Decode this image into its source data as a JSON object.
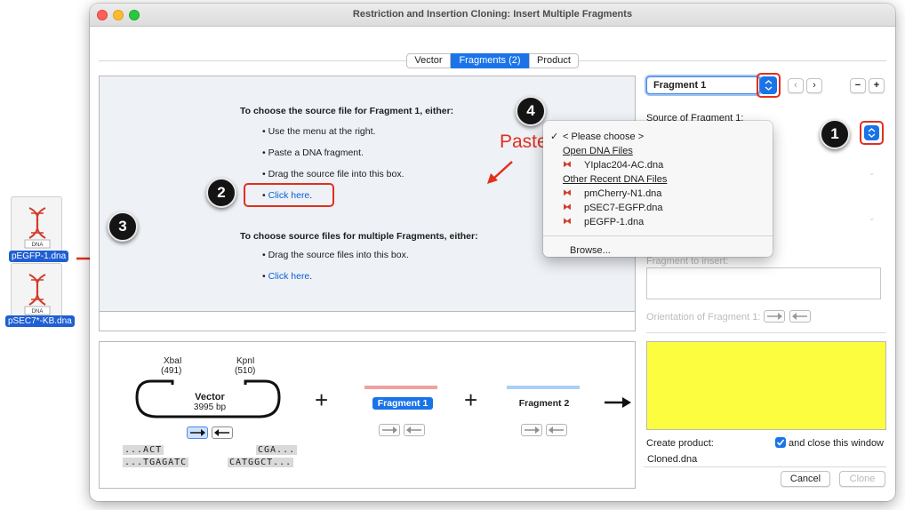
{
  "window": {
    "title": "Restriction and Insertion Cloning: Insert Multiple Fragments"
  },
  "tabs": [
    {
      "label": "Vector",
      "selected": false
    },
    {
      "label": "Fragments (2)",
      "selected": true
    },
    {
      "label": "Product",
      "selected": false
    }
  ],
  "dropzone": {
    "heading_single": "To choose the source file for Fragment 1, either:",
    "bullets_single": [
      "Use the menu at the right.",
      "Paste a DNA fragment.",
      "Drag the source file into this box."
    ],
    "click_here": "Click here",
    "period": ".",
    "heading_multi": "To choose source files for multiple Fragments, either:",
    "bullets_multi": [
      "Drag the source files into this box."
    ]
  },
  "annotations": {
    "paste": "Paste",
    "callouts": [
      "1",
      "2",
      "3",
      "4"
    ]
  },
  "desktop_files": [
    {
      "name": "pEGFP-1.dna",
      "type": "DNA"
    },
    {
      "name": "pSEC7*-KB.dna",
      "type": "DNA"
    }
  ],
  "right_panel": {
    "fragment_select": "Fragment 1",
    "source_label": "Source of Fragment 1:",
    "fragment_to_insert_label": "Fragment to insert:",
    "orientation_label": "Orientation of Fragment 1:",
    "create_product_label": "Create product:",
    "close_window_label": "and close this window",
    "close_window_checked": true,
    "product_name": "Cloned.dna",
    "cancel": "Cancel",
    "clone": "Clone",
    "preview_color": "#fdfd40"
  },
  "source_menu": {
    "selected_item": "< Please choose >",
    "section_open": "Open DNA Files",
    "open_files": [
      "YIplac204-AC.dna"
    ],
    "section_recent": "Other Recent DNA Files",
    "recent_files": [
      "pmCherry-N1.dna",
      "pSEC7-EGFP.dna",
      "pEGFP-1.dna"
    ],
    "browse": "Browse..."
  },
  "diagram": {
    "site1_name": "XbaI",
    "site1_pos": "(491)",
    "site2_name": "KpnI",
    "site2_pos": "(510)",
    "vector_label": "Vector",
    "vector_size": "3995 bp",
    "seq_left_top": "...ACT",
    "seq_left_bottom": "...TGAGATC",
    "seq_right_top": "CGA...",
    "seq_right_bottom": "CATGGCT...",
    "fragment1_label": "Fragment 1",
    "fragment2_label": "Fragment 2",
    "fragment1_color": "#f0a0a0",
    "fragment2_color": "#a9d0f5",
    "plus": "+"
  },
  "colors": {
    "accent": "#1a74e8",
    "annotation_red": "#e0301e"
  }
}
